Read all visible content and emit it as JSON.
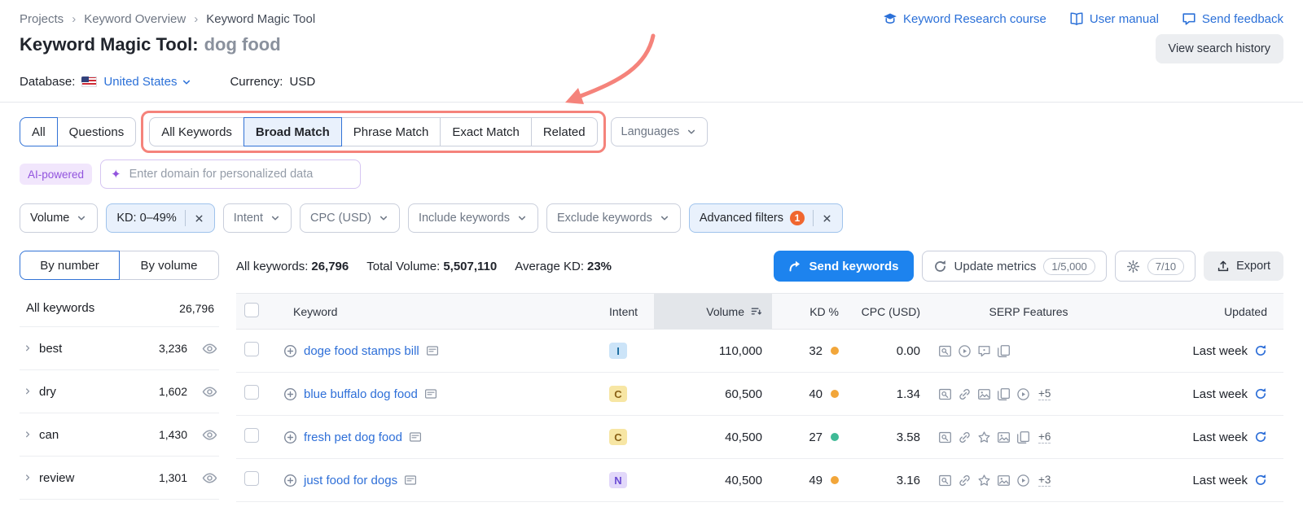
{
  "breadcrumb": {
    "items": [
      "Projects",
      "Keyword Overview",
      "Keyword Magic Tool"
    ],
    "separator": "›"
  },
  "header_links": {
    "course": "Keyword Research course",
    "manual": "User manual",
    "feedback": "Send feedback"
  },
  "page": {
    "title": "Keyword Magic Tool:",
    "query": "dog food",
    "view_history": "View search history",
    "database_label": "Database:",
    "database_value": "United States",
    "currency_label": "Currency:",
    "currency_value": "USD"
  },
  "tabs": {
    "all": "All",
    "questions": "Questions",
    "match": [
      "All Keywords",
      "Broad Match",
      "Phrase Match",
      "Exact Match",
      "Related"
    ],
    "languages": "Languages"
  },
  "ai": {
    "badge": "AI-powered",
    "placeholder": "Enter domain for personalized data"
  },
  "filters": {
    "volume": "Volume",
    "kd": "KD: 0–49%",
    "intent": "Intent",
    "cpc": "CPC (USD)",
    "include": "Include keywords",
    "exclude": "Exclude keywords",
    "advanced": "Advanced filters",
    "advanced_badge": "1"
  },
  "sidebar": {
    "tab_by_number": "By number",
    "tab_by_volume": "By volume",
    "all_label": "All keywords",
    "all_count": "26,796",
    "groups": [
      {
        "name": "best",
        "count": "3,236"
      },
      {
        "name": "dry",
        "count": "1,602"
      },
      {
        "name": "can",
        "count": "1,430"
      },
      {
        "name": "review",
        "count": "1,301"
      }
    ]
  },
  "stats": {
    "all_label": "All keywords:",
    "all_value": "26,796",
    "volume_label": "Total Volume:",
    "volume_value": "5,507,110",
    "kd_label": "Average KD:",
    "kd_value": "23%"
  },
  "actions": {
    "send": "Send keywords",
    "update": "Update metrics",
    "update_quota": "1/5,000",
    "gear_quota": "7/10",
    "export": "Export"
  },
  "table": {
    "headers": {
      "keyword": "Keyword",
      "intent": "Intent",
      "volume": "Volume",
      "kd": "KD %",
      "cpc": "CPC (USD)",
      "serp": "SERP Features",
      "updated": "Updated"
    },
    "rows": [
      {
        "keyword": "doge food stamps bill",
        "intent": {
          "letter": "I",
          "bg": "#cce4f8",
          "color": "#17699e"
        },
        "volume": "110,000",
        "kd": "32",
        "kd_color": "#f2a63a",
        "cpc": "0.00",
        "serp_icons": [
          "serp-preview",
          "video",
          "faq",
          "pages",
          "list"
        ],
        "serp_more": "",
        "updated": "Last week"
      },
      {
        "keyword": "blue buffalo dog food",
        "intent": {
          "letter": "C",
          "bg": "#f7e6a4",
          "color": "#8a6116"
        },
        "volume": "60,500",
        "kd": "40",
        "kd_color": "#f2a63a",
        "cpc": "1.34",
        "serp_icons": [
          "serp-preview",
          "link",
          "image",
          "pages",
          "video"
        ],
        "serp_more": "+5",
        "updated": "Last week"
      },
      {
        "keyword": "fresh pet dog food",
        "intent": {
          "letter": "C",
          "bg": "#f7e6a4",
          "color": "#8a6116"
        },
        "volume": "40,500",
        "kd": "27",
        "kd_color": "#3fba96",
        "cpc": "3.58",
        "serp_icons": [
          "serp-preview",
          "link",
          "star",
          "image",
          "pages"
        ],
        "serp_more": "+6",
        "updated": "Last week"
      },
      {
        "keyword": "just food for dogs",
        "intent": {
          "letter": "N",
          "bg": "#e2d8fa",
          "color": "#6a4bd4"
        },
        "volume": "40,500",
        "kd": "49",
        "kd_color": "#f2a63a",
        "cpc": "3.16",
        "serp_icons": [
          "serp-preview",
          "link",
          "star",
          "image",
          "video"
        ],
        "serp_more": "+3",
        "updated": "Last week"
      }
    ]
  },
  "annotation": {
    "highlight_color": "#f5837b"
  }
}
